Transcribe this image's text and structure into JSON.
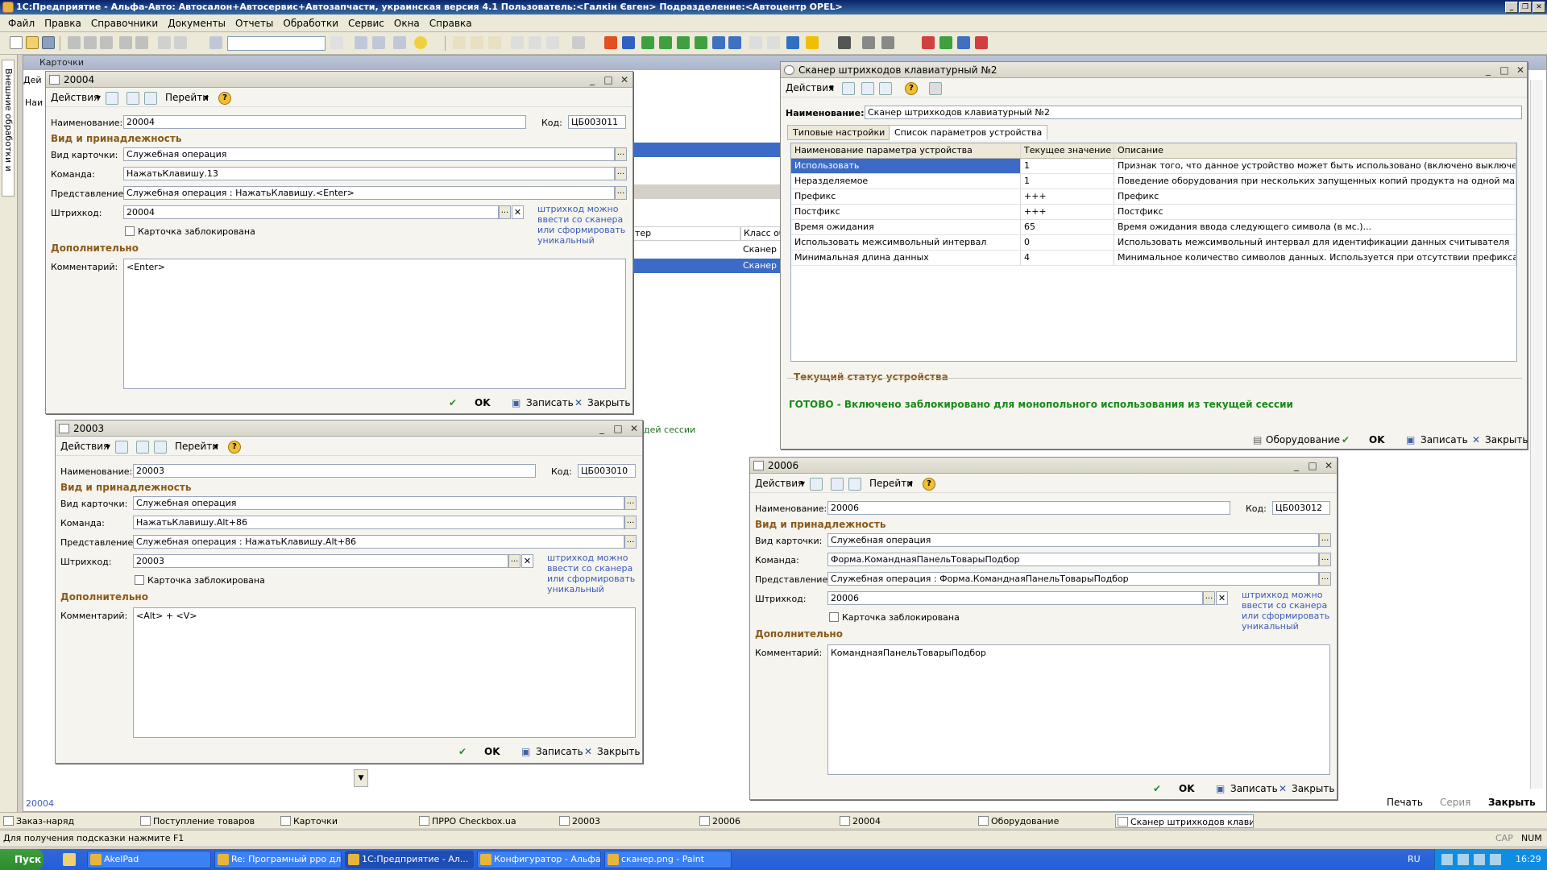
{
  "app": {
    "title": "1С:Предприятие - Альфа-Авто: Автосалон+Автосервис+Автозапчасти, украинская версия 4.1    Пользователь:<Галкін Євген>    Подразделение:<Автоцентр OPEL>"
  },
  "menu": [
    "Файл",
    "Правка",
    "Справочники",
    "Документы",
    "Отчеты",
    "Обработки",
    "Сервис",
    "Окна",
    "Справка"
  ],
  "left_panel": {
    "label": "Внешние обработки и отчеты"
  },
  "cards_window": {
    "title": "Карточки",
    "left_fragments": [
      "Дей",
      "Наи"
    ],
    "col_header_1": "тер",
    "col_header_2": "Класс оборудо",
    "cell_1": "Сканер штрихк",
    "cell_2": "Сканер штрихк",
    "lower_text": "дей сессии",
    "footer_code": "20004",
    "footer_buttons": {
      "print": "Печать",
      "series": "Серия",
      "close": "Закрыть"
    }
  },
  "form_20004": {
    "title": "20004",
    "actions": "Действия",
    "goto": "Перейти",
    "name_label": "Наименование:",
    "name_value": "20004",
    "code_label": "Код:",
    "code_value": "ЦБ003011",
    "section_kind": "Вид и принадлежность",
    "kind_label": "Вид карточки:",
    "kind_value": "Служебная операция",
    "command_label": "Команда:",
    "command_value": "НажатьКлавишу.13",
    "repr_label": "Представление:",
    "repr_value": "Служебная операция : НажатьКлавишу.<Enter>",
    "barcode_label": "Штрихкод:",
    "barcode_value": "20004",
    "hint": [
      "штрихкод можно",
      "ввести со сканера",
      "или сформировать",
      "уникальный"
    ],
    "locked_label": "Карточка заблокирована",
    "section_extra": "Дополнительно",
    "comment_label": "Комментарий:",
    "comment_value": "<Enter>",
    "ok": "OK",
    "save": "Записать",
    "close": "Закрыть"
  },
  "form_20003": {
    "title": "20003",
    "actions": "Действия",
    "goto": "Перейти",
    "name_label": "Наименование:",
    "name_value": "20003",
    "code_label": "Код:",
    "code_value": "ЦБ003010",
    "section_kind": "Вид и принадлежность",
    "kind_label": "Вид карточки:",
    "kind_value": "Служебная операция",
    "command_label": "Команда:",
    "command_value": "НажатьКлавишу.Alt+86",
    "repr_label": "Представление:",
    "repr_value": "Служебная операция : НажатьКлавишу.Alt+86",
    "barcode_label": "Штрихкод:",
    "barcode_value": "20003",
    "hint": [
      "штрихкод можно",
      "ввести со сканера",
      "или сформировать",
      "уникальный"
    ],
    "locked_label": "Карточка заблокирована",
    "section_extra": "Дополнительно",
    "comment_label": "Комментарий:",
    "comment_value": "<Alt> + <V>",
    "ok": "OK",
    "save": "Записать",
    "close": "Закрыть"
  },
  "form_20006": {
    "title": "20006",
    "actions": "Действия",
    "goto": "Перейти",
    "name_label": "Наименование:",
    "name_value": "20006",
    "code_label": "Код:",
    "code_value": "ЦБ003012",
    "section_kind": "Вид и принадлежность",
    "kind_label": "Вид карточки:",
    "kind_value": "Служебная операция",
    "command_label": "Команда:",
    "command_value": "Форма.КоманднаяПанельТоварыПодбор",
    "repr_label": "Представление:",
    "repr_value": "Служебная операция : Форма.КоманднаяПанельТоварыПодбор",
    "barcode_label": "Штрихкод:",
    "barcode_value": "20006",
    "hint": [
      "штрихкод можно",
      "ввести со сканера",
      "или сформировать",
      "уникальный"
    ],
    "locked_label": "Карточка заблокирована",
    "section_extra": "Дополнительно",
    "comment_label": "Комментарий:",
    "comment_value": "КоманднаяПанельТоварыПодбор",
    "ok": "OK",
    "save": "Записать",
    "close": "Закрыть"
  },
  "scanner": {
    "title": "Сканер штрихкодов клавиатурный №2",
    "actions": "Действия",
    "name_label": "Наименование:",
    "name_value": "Сканер штрихкодов клавиатурный №2",
    "tabs": [
      "Типовые настройки",
      "Список параметров устройства"
    ],
    "columns": [
      "Наименование параметра устройства",
      "Текущее значение",
      "Описание"
    ],
    "rows": [
      [
        "Использовать",
        "1",
        "Признак того, что данное устройство может быть использовано (включено выключено и т.д.)..."
      ],
      [
        "Неразделяемое",
        "1",
        "Поведение оборудования при нескольких запущенных копий продукта на одной машине или в ..."
      ],
      [
        "Префикс",
        "+++",
        "Префикс"
      ],
      [
        "Постфикс",
        "+++",
        "Постфикс"
      ],
      [
        "Время ожидания",
        "65",
        "Время ожидания ввода следующего символа (в мс.)..."
      ],
      [
        "Использовать межсимвольный интервал",
        "0",
        "Использовать межсимвольный интервал для идентификации данных считывателя"
      ],
      [
        "Минимальная длина данных",
        "4",
        "Минимальное количество символов данных. Используется при отсутствии префикса и постфи..."
      ]
    ],
    "status_section": "Текущий статус устройства",
    "status_text": "ГОТОВО - Включено заблокировано для монопольного использования из текущей сессии",
    "equipment": "Оборудование",
    "ok": "OK",
    "save": "Записать",
    "close": "Закрыть"
  },
  "window_tabs": [
    "Заказ-наряд",
    "Поступление товаров",
    "Карточки",
    "ПРРО Checkbox.ua",
    "20003",
    "20006",
    "20004",
    "Оборудование",
    "Сканер штрихкодов клавиат..."
  ],
  "hint_bar": "Для получения подсказки нажмите F1",
  "indicators": [
    "CAP",
    "NUM"
  ],
  "taskbar": {
    "start": "Пуск",
    "tasks": [
      "AkelPad",
      "Re: Програмный рро дл...",
      "1С:Предприятие - Ал...",
      "Конфигуратор - Альфа...",
      "сканер.png - Paint"
    ],
    "lang": "RU",
    "time": "16:29"
  }
}
